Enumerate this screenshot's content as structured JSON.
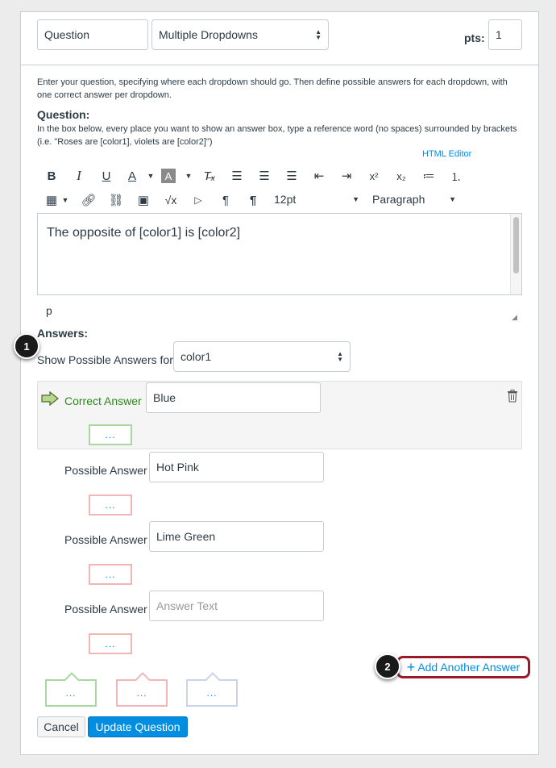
{
  "header": {
    "question_title_value": "Question",
    "question_type": "Multiple Dropdowns",
    "pts_label": "pts:",
    "pts_value": "1"
  },
  "instructions": {
    "intro": "Enter your question, specifying where each dropdown should go. Then define possible answers for each dropdown, with one correct answer per dropdown.",
    "question_heading": "Question:",
    "question_help": "In the box below, every place you want to show an answer box, type a reference word (no spaces) surrounded by brackets (i.e. \"Roses are [color1], violets are [color2]\")",
    "html_editor_link": "HTML Editor"
  },
  "toolbar": {
    "font_size": "12pt",
    "block_format": "Paragraph"
  },
  "editor": {
    "content": "The opposite of [color1] is [color2]",
    "path": "p"
  },
  "answers": {
    "heading": "Answers:",
    "show_label": "Show Possible Answers for",
    "selected_blank": "color1",
    "correct_label": "Correct Answer",
    "correct_value": "Blue",
    "possible_label": "Possible Answer",
    "possible": [
      {
        "value": "Hot Pink"
      },
      {
        "value": "Lime Green"
      },
      {
        "value": ""
      }
    ],
    "answer_placeholder": "Answer Text",
    "comment_ellipsis": "...",
    "add_another": "Add Another Answer"
  },
  "actions": {
    "cancel": "Cancel",
    "update": "Update Question"
  },
  "callouts": [
    "1",
    "2"
  ],
  "colors": {
    "accent": "#008ee2",
    "correct_green": "#2a8a1a",
    "callout_highlight": "#9b1a2a",
    "primary_button": "#008ee2"
  }
}
